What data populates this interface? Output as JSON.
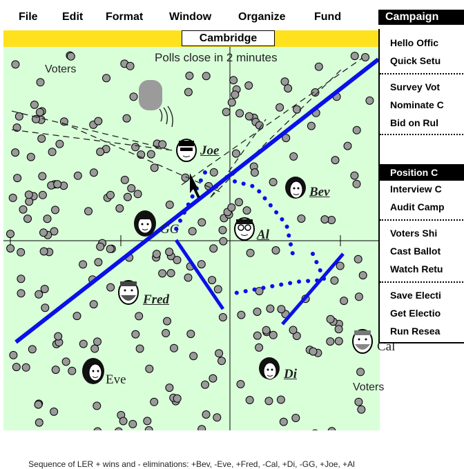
{
  "menubar": {
    "items": [
      "File",
      "Edit",
      "Format",
      "Window",
      "Organize",
      "Fund"
    ],
    "active": "Campaign"
  },
  "window": {
    "title": "Cambridge"
  },
  "canvas": {
    "status": "Polls close in 2 minutes",
    "voters_label_top": "Voters",
    "voters_label_bottom": "Voters",
    "footer": "Sequence of LER + wins and - eliminations: +Bev, -Eve, +Fred, -Cal, +Di, -GG, +Joe, +Al",
    "candidates": {
      "joe": "Joe",
      "bev": "Bev",
      "gg": "GG",
      "al": "Al",
      "fred": "Fred",
      "eve": "Eve",
      "di": "Di",
      "cal": "Cal"
    }
  },
  "dropdown": {
    "items": {
      "hello_office": "Hello Offic",
      "quick_setup": "Quick Setu",
      "survey_voters": "Survey Vot",
      "nominate": "Nominate C",
      "bid_on_rules": "Bid on Rul",
      "position": "Position C",
      "interview": "Interview C",
      "audit": "Audit Camp",
      "voters_shift": "Voters Shi",
      "cast_ballots": "Cast Ballot",
      "watch_returns": "Watch Retu",
      "save_election": "Save Electi",
      "get_election": "Get Electio",
      "run_research": "Run Resea"
    }
  },
  "colors": {
    "accent": "#0a10e8",
    "title_bar": "#ffe21d",
    "canvas_bg": "#d9ffd9"
  }
}
